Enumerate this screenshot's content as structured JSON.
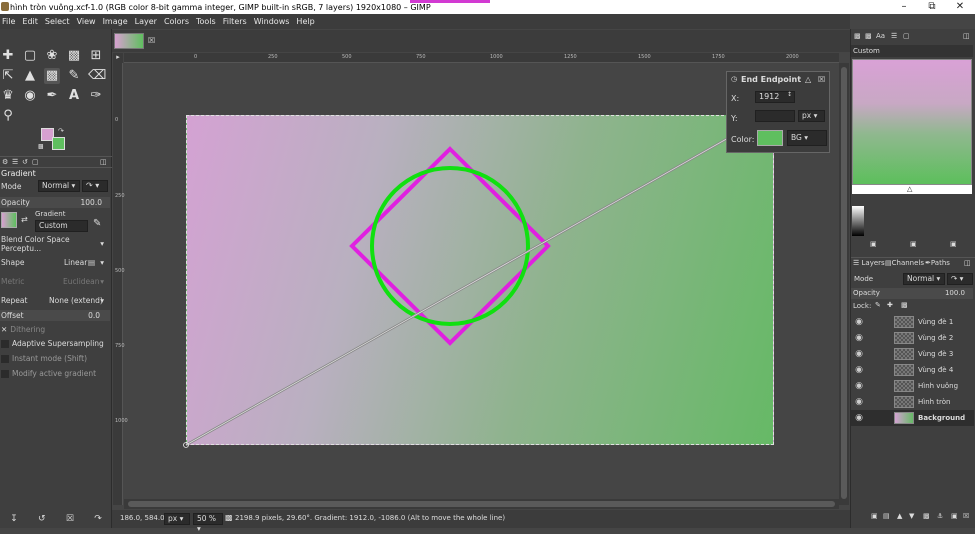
{
  "window": {
    "title": "hình tròn vuông.xcf-1.0 (RGB color 8-bit gamma integer, GIMP built-in sRGB, 7 layers) 1920x1080 – GIMP",
    "minimize_icon": "minimize-icon",
    "maximize_icon": "maximize-icon",
    "close_icon": "close-icon"
  },
  "menu": [
    "File",
    "Edit",
    "Select",
    "View",
    "Image",
    "Layer",
    "Colors",
    "Tools",
    "Filters",
    "Windows",
    "Help"
  ],
  "tool_options": {
    "panel_title": "Gradient",
    "mode_label": "Mode",
    "mode_value": "Normal",
    "opacity_label": "Opacity",
    "opacity_value": "100.0",
    "gradient_label": "Gradient",
    "gradient_value": "Custom",
    "blend_space_value": "Blend Color Space Perceptu...",
    "shape_label": "Shape",
    "shape_value": "Linear",
    "metric_label": "Metric",
    "metric_value": "Euclidean",
    "repeat_label": "Repeat",
    "repeat_value": "None (extend)",
    "offset_label": "Offset",
    "offset_value": "0.0",
    "dithering_label": "Dithering",
    "adaptive_label": "Adaptive Supersampling",
    "instant_label": "Instant mode  (Shift)",
    "modify_label": "Modify active gradient"
  },
  "ruler": {
    "h_ticks": [
      "0",
      "250",
      "500",
      "750",
      "1000",
      "1250",
      "1500",
      "1750",
      "2000"
    ],
    "v_ticks": [
      "0",
      "250",
      "500",
      "750",
      "1000"
    ]
  },
  "endpoint_dialog": {
    "title": "End Endpoint",
    "x_label": "X:",
    "x_value": "1912",
    "y_label": "Y:",
    "unit": "px",
    "color_label": "Color:",
    "color_mode": "BG"
  },
  "statusbar": {
    "coords": "186.0, 584.0",
    "unit": "px",
    "zoom": "50 %",
    "message": "2198.9 pixels, 29.60°. Gradient: 1912.0, -1086.0 (Alt to move the whole line)"
  },
  "right_dock": {
    "gradient_name": "Custom",
    "tabs": [
      "Layers",
      "Channels",
      "Paths"
    ],
    "mode_label": "Mode",
    "mode_value": "Normal",
    "opacity_label": "Opacity",
    "opacity_value": "100.0",
    "lock_label": "Lock:",
    "layers": [
      "Vùng đè 1",
      "Vùng đè 2",
      "Vùng đè 3",
      "Vùng đè 4",
      "Hình vuông",
      "Hình tròn",
      "Background"
    ]
  },
  "colors": {
    "fg": "#d7a0d0",
    "bg": "#5fbf5f",
    "square_stroke": "#e020e0",
    "circle_stroke": "#10e010"
  }
}
